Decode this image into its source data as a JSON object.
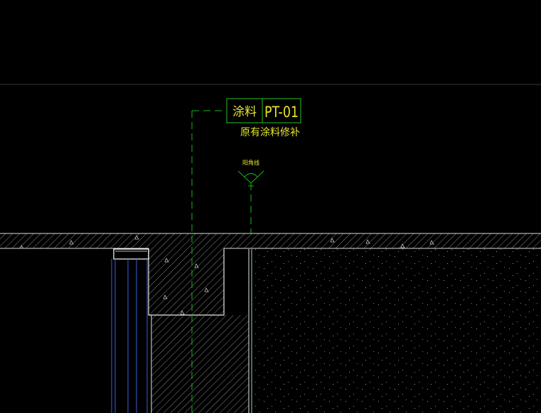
{
  "tag": {
    "material": "涂料",
    "code": "PT-01",
    "note": "原有涂料修补"
  },
  "angle_label": "阳角线",
  "colors": {
    "background": "#000000",
    "tag_box": "#27c01e",
    "tag_text": "#e7e62b",
    "leader": "#18b818",
    "hatch": "#bdbdbd",
    "outline": "#ffffff",
    "glass": "#3a5be0",
    "cyan": "#8ad9d9"
  }
}
